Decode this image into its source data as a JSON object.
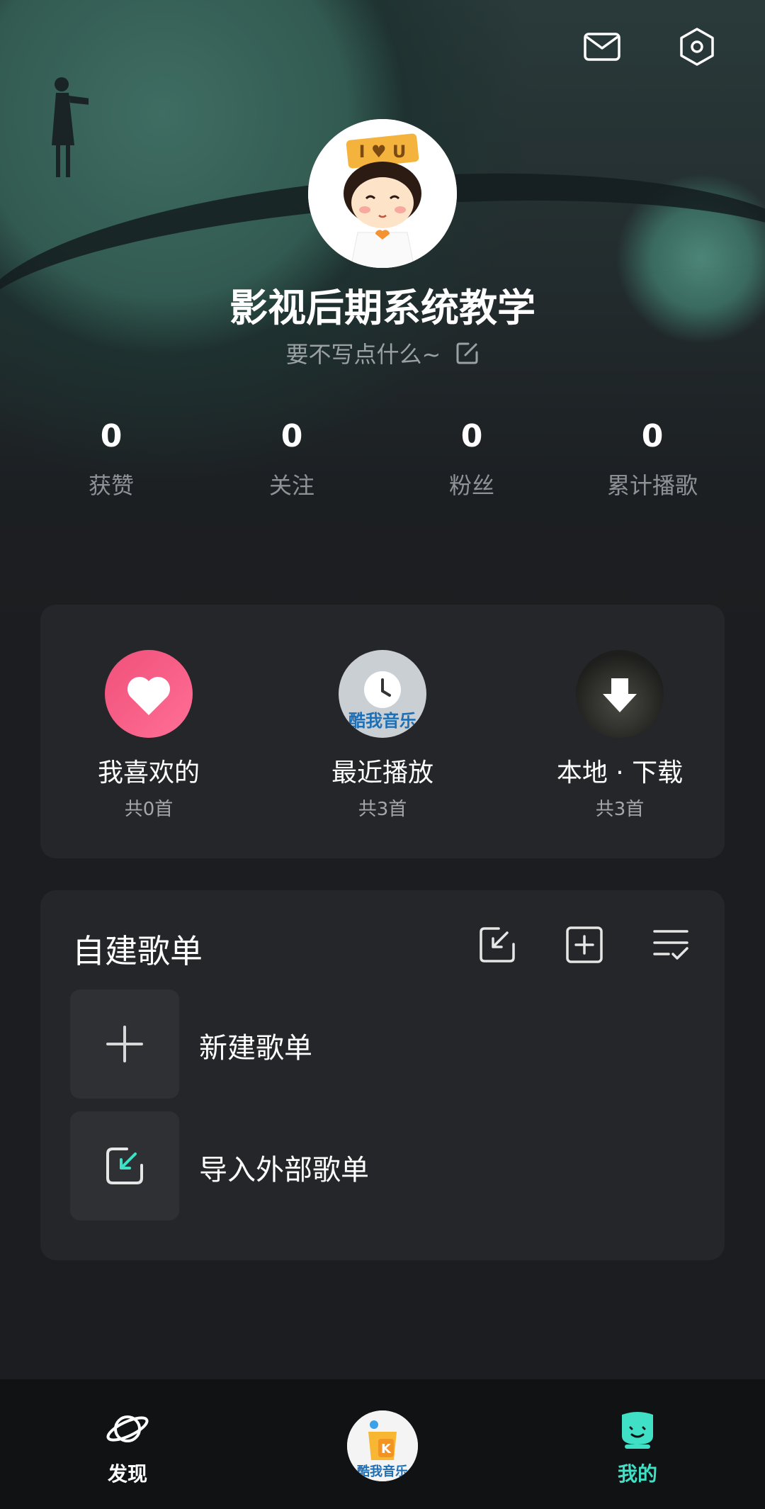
{
  "header": {
    "mail_icon": "mail-icon",
    "settings_icon": "settings-hexagon-icon"
  },
  "profile": {
    "avatar": "avatar-cartoon-i-love-u",
    "avatar_text": "I ♥ U",
    "name": "影视后期系统教学",
    "signature": "要不写点什么~"
  },
  "stats": [
    {
      "value": "0",
      "label": "获赞"
    },
    {
      "value": "0",
      "label": "关注"
    },
    {
      "value": "0",
      "label": "粉丝"
    },
    {
      "value": "0",
      "label": "累计播歌"
    }
  ],
  "quick_access": [
    {
      "title": "我喜欢的",
      "sub": "共0首",
      "icon": "heart-icon",
      "color": "#f0507a"
    },
    {
      "title": "最近播放",
      "sub": "共3首",
      "icon": "clock-icon",
      "cover_text": "酷我音乐"
    },
    {
      "title": "本地 · 下载",
      "sub": "共3首",
      "icon": "download-arrow-icon"
    }
  ],
  "playlists": {
    "title": "自建歌单",
    "tools": [
      "import-icon",
      "add-square-icon",
      "sort-list-icon"
    ],
    "rows": [
      {
        "label": "新建歌单",
        "icon": "plus-icon"
      },
      {
        "label": "导入外部歌单",
        "icon": "import-arrow-icon"
      }
    ]
  },
  "tabbar": {
    "tabs": [
      {
        "label": "发现",
        "icon": "planet-icon"
      },
      {
        "label": "我的",
        "icon": "mine-face-icon",
        "active": true
      }
    ],
    "center_logo_text": "酷我音乐",
    "active_color": "#3fe0c5"
  }
}
